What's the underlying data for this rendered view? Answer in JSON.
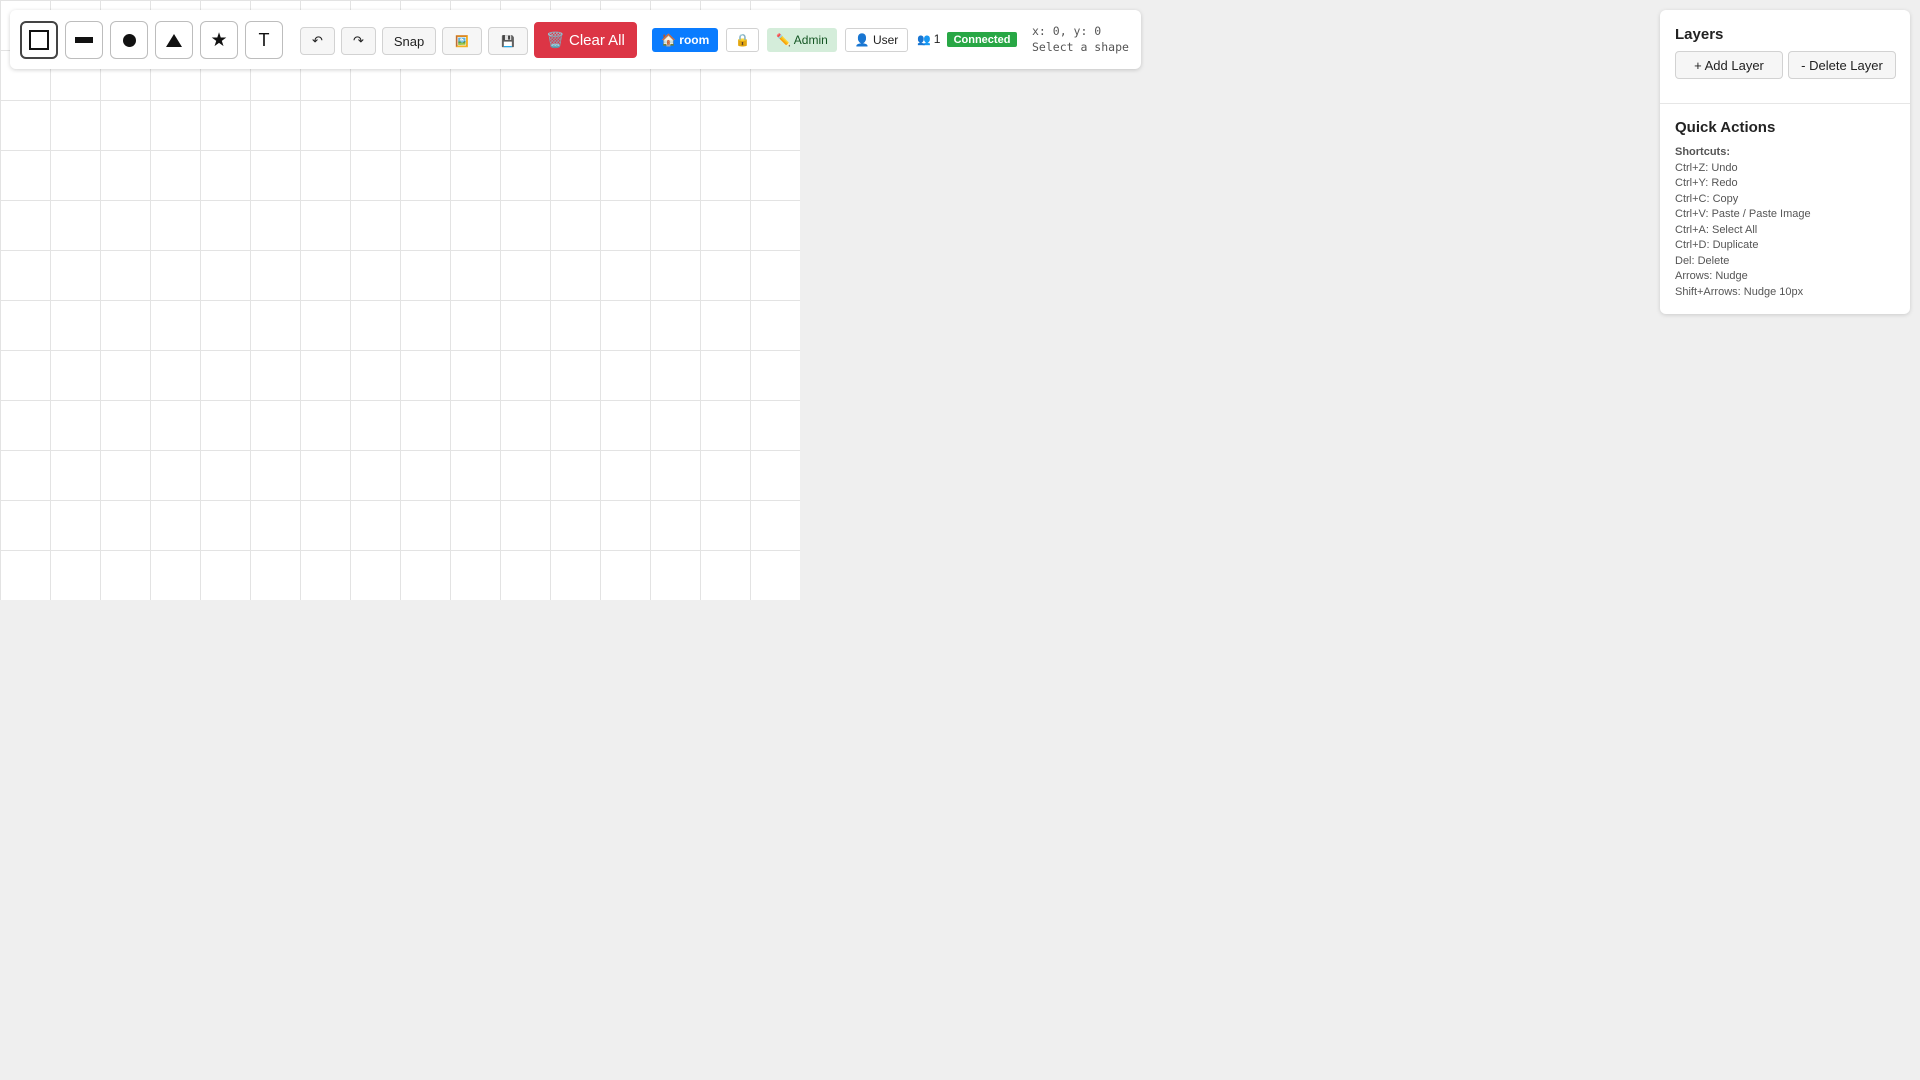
{
  "toolbar": {
    "tools": [
      {
        "name": "rectangle-tool",
        "glyph": "□"
      },
      {
        "name": "line-tool",
        "glyph": "▬"
      },
      {
        "name": "circle-tool",
        "glyph": "●"
      },
      {
        "name": "triangle-tool",
        "glyph": "▲"
      },
      {
        "name": "star-tool",
        "glyph": "★"
      },
      {
        "name": "text-tool",
        "glyph": "T"
      }
    ],
    "undo_glyph": "↶",
    "redo_glyph": "↷",
    "snap_label": "Snap",
    "image_glyph": "🖼️",
    "save_glyph": "💾",
    "clear_label": "🗑️ Clear All",
    "room_label": "🏠 room",
    "lock_glyph": "🔒",
    "admin_label": "✏️ Admin",
    "user_label": "👤 User",
    "users_glyph": "👥",
    "user_count": "1",
    "status_label": "Connected",
    "coords_text": "x: 0, y: 0",
    "hint_text": "Select a shape"
  },
  "layers": {
    "title": "Layers",
    "add_label": "+ Add Layer",
    "delete_label": "- Delete Layer"
  },
  "quick_actions": {
    "title": "Quick Actions",
    "shortcuts_heading": "Shortcuts:",
    "shortcuts": [
      "Ctrl+Z: Undo",
      "Ctrl+Y: Redo",
      "Ctrl+C: Copy",
      "Ctrl+V: Paste / Paste Image",
      "Ctrl+A: Select All",
      "Ctrl+D: Duplicate",
      "Del: Delete",
      "Arrows: Nudge",
      "Shift+Arrows: Nudge 10px"
    ]
  },
  "colors": {
    "danger": "#dc3545",
    "primary": "#0a7cff",
    "success": "#28a745",
    "admin_bg": "#d4edda"
  }
}
